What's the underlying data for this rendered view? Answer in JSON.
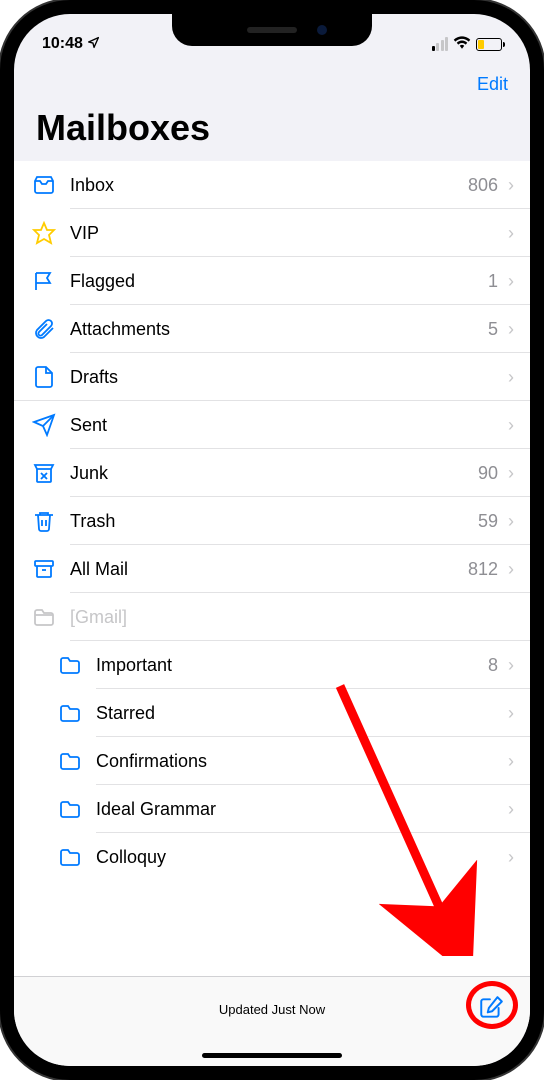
{
  "status_bar": {
    "time": "10:48"
  },
  "nav": {
    "edit": "Edit"
  },
  "title": "Mailboxes",
  "mailboxes": [
    {
      "icon": "inbox",
      "label": "Inbox",
      "count": "806",
      "indent": 0
    },
    {
      "icon": "star",
      "label": "VIP",
      "count": "",
      "indent": 0
    },
    {
      "icon": "flag",
      "label": "Flagged",
      "count": "1",
      "indent": 0
    },
    {
      "icon": "attachment",
      "label": "Attachments",
      "count": "5",
      "indent": 0
    },
    {
      "icon": "draft",
      "label": "Drafts",
      "count": "",
      "indent": 0,
      "fullsep": true
    },
    {
      "icon": "sent",
      "label": "Sent",
      "count": "",
      "indent": 0
    },
    {
      "icon": "junk",
      "label": "Junk",
      "count": "90",
      "indent": 0
    },
    {
      "icon": "trash",
      "label": "Trash",
      "count": "59",
      "indent": 0
    },
    {
      "icon": "allmail",
      "label": "All Mail",
      "count": "812",
      "indent": 0
    },
    {
      "icon": "folder-gray",
      "label": "[Gmail]",
      "count": "",
      "indent": 0,
      "disabled": true,
      "nochevron": true
    },
    {
      "icon": "folder",
      "label": "Important",
      "count": "8",
      "indent": 1
    },
    {
      "icon": "folder",
      "label": "Starred",
      "count": "",
      "indent": 1
    },
    {
      "icon": "folder",
      "label": "Confirmations",
      "count": "",
      "indent": 1
    },
    {
      "icon": "folder",
      "label": "Ideal Grammar",
      "count": "",
      "indent": 1
    },
    {
      "icon": "folder",
      "label": "Colloquy",
      "count": "",
      "indent": 1,
      "nosep": true
    }
  ],
  "toolbar": {
    "status": "Updated Just Now"
  },
  "colors": {
    "accent": "#007aff",
    "star": "#ffcc00",
    "annotation": "#ff0000"
  }
}
